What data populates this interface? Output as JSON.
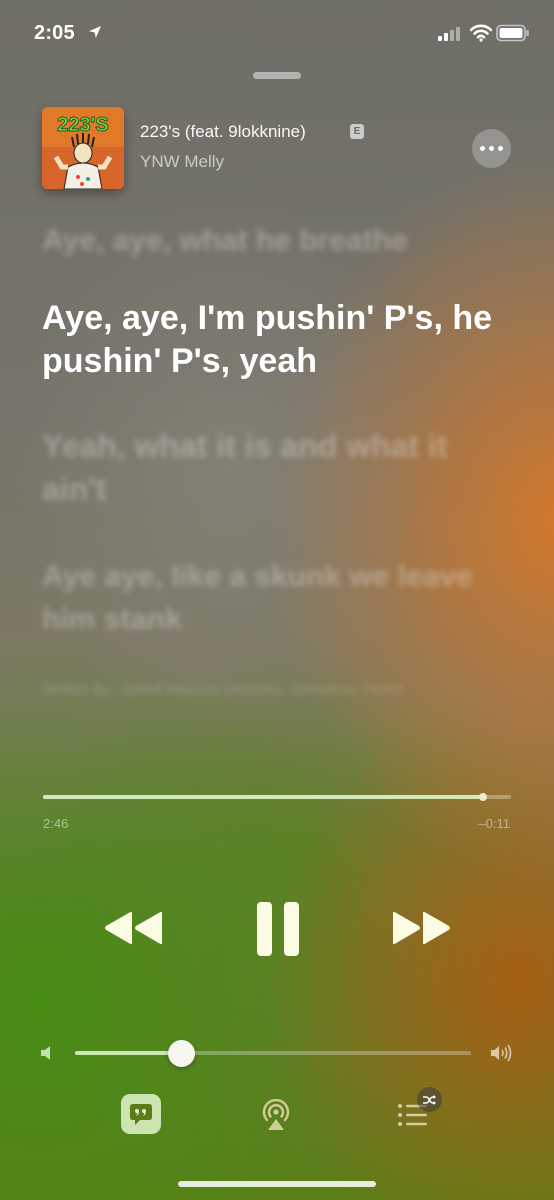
{
  "status_bar": {
    "time": "2:05",
    "icons": [
      "location-arrow-icon",
      "cellular-signal-icon",
      "wifi-icon",
      "battery-icon"
    ]
  },
  "now_playing": {
    "artwork_text": "223'S",
    "title": "223's (feat. 9lokknine)",
    "explicit_badge": "E",
    "artist": "YNW Melly"
  },
  "lyrics": {
    "previous": "Aye, aye, what he breathe",
    "current": "Aye, aye, I'm pushin' P's, he pushin' P's, yeah",
    "next_1": "Yeah, what it is and what it ain't",
    "next_2": "Aye aye, like a skunk we leave him stank",
    "credits": "Written By: Jamell Maurice Demons, Johnathan Porter"
  },
  "playback": {
    "elapsed": "2:46",
    "remaining": "–0:11",
    "progress_fraction": 0.94
  },
  "volume": {
    "level_fraction": 0.27
  },
  "colors": {
    "accent_green": "#5b7d18",
    "accent_orange": "#d67828"
  }
}
